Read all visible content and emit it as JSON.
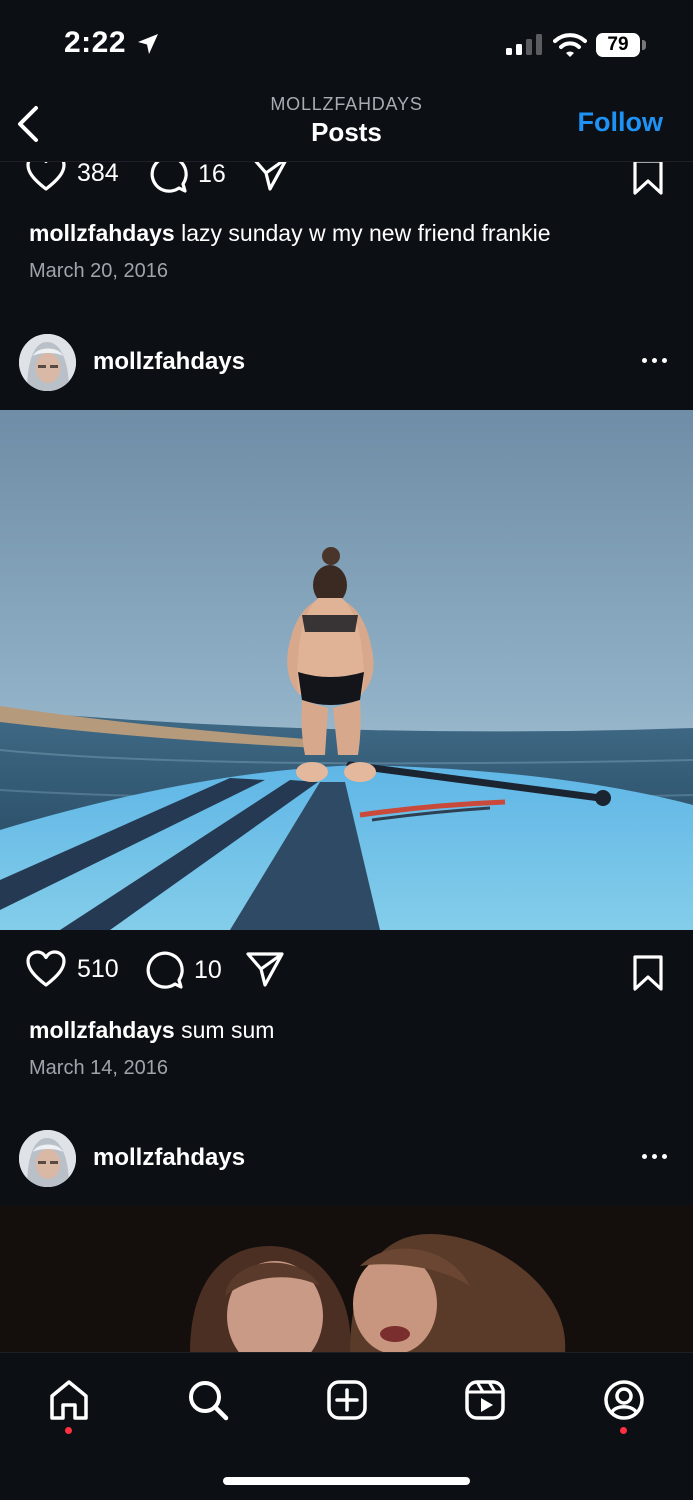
{
  "status_bar": {
    "time": "2:22",
    "battery": "79"
  },
  "header": {
    "account": "MOLLZFAHDAYS",
    "title": "Posts",
    "follow_label": "Follow"
  },
  "posts": [
    {
      "likes": "384",
      "comments": "16",
      "caption_user": "mollzfahdays",
      "caption_text": " lazy sunday w my new friend frankie",
      "date": "March 20, 2016"
    },
    {
      "username": "mollzfahdays",
      "image": "paddleboard-ocean-photo",
      "likes": "510",
      "comments": "10",
      "caption_user": "mollzfahdays",
      "caption_text": " sum sum",
      "date": "March 14, 2016"
    },
    {
      "username": "mollzfahdays",
      "image": "night-selfie-photo"
    }
  ],
  "icons": {
    "like": "heart-icon",
    "comment": "comment-icon",
    "share": "paper-plane-icon",
    "save": "bookmark-icon",
    "options": "more-options-icon"
  },
  "bottom_nav": [
    "home-icon",
    "search-icon",
    "create-icon",
    "reels-icon",
    "profile-icon"
  ],
  "colors": {
    "background": "#0c0f14",
    "accent": "#1e93f5",
    "notification_dot": "#ff3040"
  }
}
